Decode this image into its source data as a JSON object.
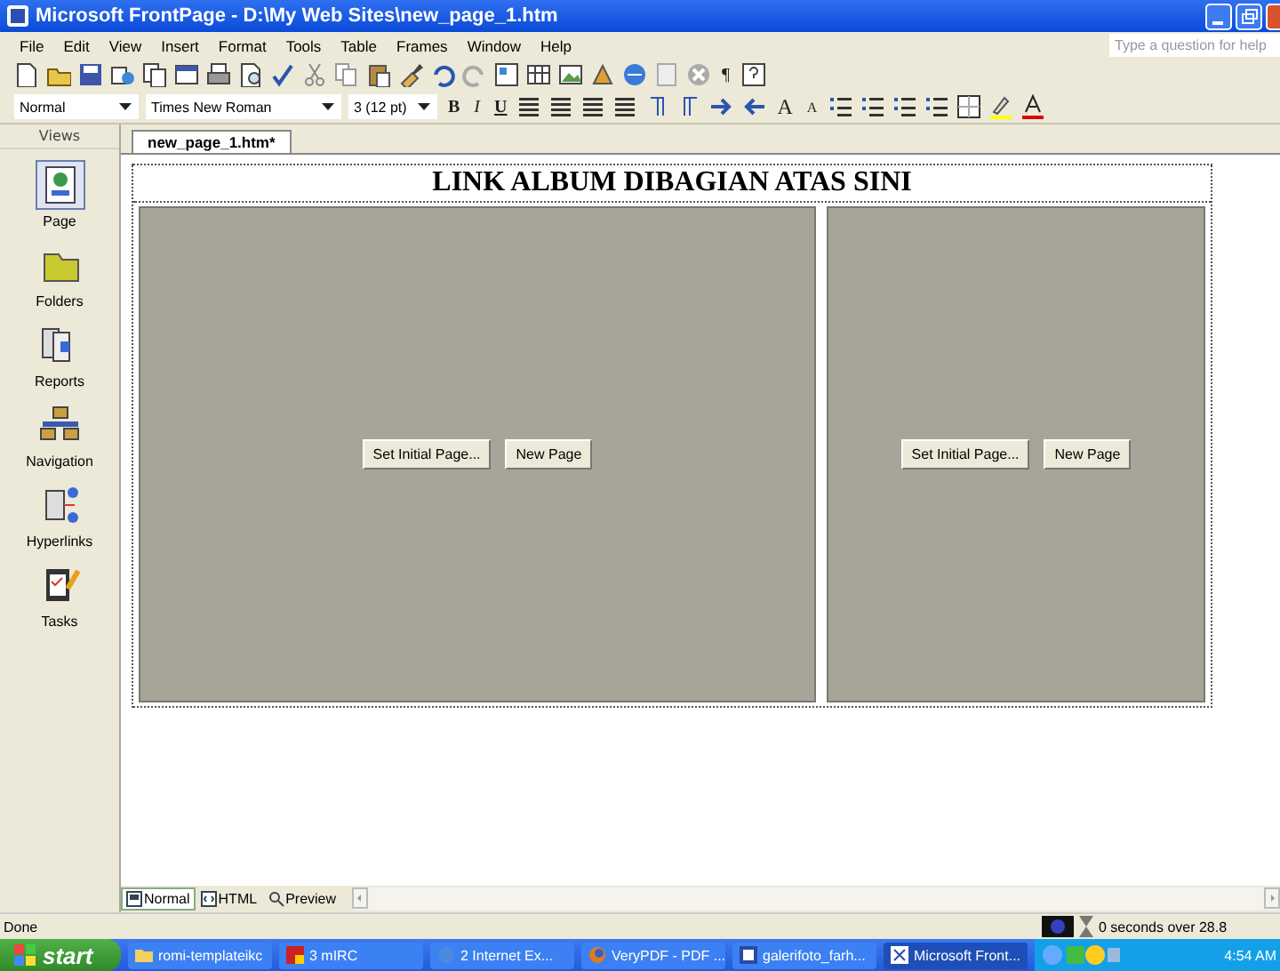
{
  "window": {
    "title": "Microsoft FrontPage - D:\\My Web Sites\\new_page_1.htm"
  },
  "menu": [
    {
      "label": "File"
    },
    {
      "label": "Edit"
    },
    {
      "label": "View"
    },
    {
      "label": "Insert"
    },
    {
      "label": "Format"
    },
    {
      "label": "Tools"
    },
    {
      "label": "Table"
    },
    {
      "label": "Frames"
    },
    {
      "label": "Window"
    },
    {
      "label": "Help"
    }
  ],
  "help_box": {
    "placeholder": "Type a question for help"
  },
  "standard_toolbar": {
    "pilcrow": "¶"
  },
  "formatting_toolbar": {
    "style": "Normal",
    "font": "Times New Roman",
    "size": "3 (12 pt)",
    "text_buttons": [
      "B",
      "I",
      "U"
    ],
    "grow_font": "A",
    "shrink_font": "A"
  },
  "views": {
    "header": "Views",
    "items": [
      {
        "label": "Page",
        "selected": true
      },
      {
        "label": "Folders",
        "selected": false
      },
      {
        "label": "Reports",
        "selected": false
      },
      {
        "label": "Navigation",
        "selected": false
      },
      {
        "label": "Hyperlinks",
        "selected": false
      },
      {
        "label": "Tasks",
        "selected": false
      }
    ]
  },
  "document_tab": {
    "label": "new_page_1.htm*"
  },
  "page": {
    "heading": "LINK ALBUM DIBAGIAN ATAS SINI",
    "frames": [
      {
        "buttons": [
          "Set Initial Page...",
          "New Page"
        ]
      },
      {
        "buttons": [
          "Set Initial Page...",
          "New Page"
        ]
      }
    ]
  },
  "view_tabs": [
    {
      "label": "Normal",
      "selected": true
    },
    {
      "label": "HTML",
      "selected": false
    },
    {
      "label": "Preview",
      "selected": false
    }
  ],
  "status_bar": {
    "text": "Done",
    "download_time": "0 seconds over 28.8"
  },
  "taskbar": {
    "start": "start",
    "tasks": [
      {
        "label": "romi-templateikc",
        "selected": false
      },
      {
        "label": "3 mIRC",
        "selected": false
      },
      {
        "label": "2 Internet Ex...",
        "selected": false
      },
      {
        "label": "VeryPDF - PDF ...",
        "selected": false
      },
      {
        "label": "galerifoto_farh...",
        "selected": false
      },
      {
        "label": "Microsoft Front...",
        "selected": true
      }
    ],
    "clock": "4:54 AM"
  }
}
